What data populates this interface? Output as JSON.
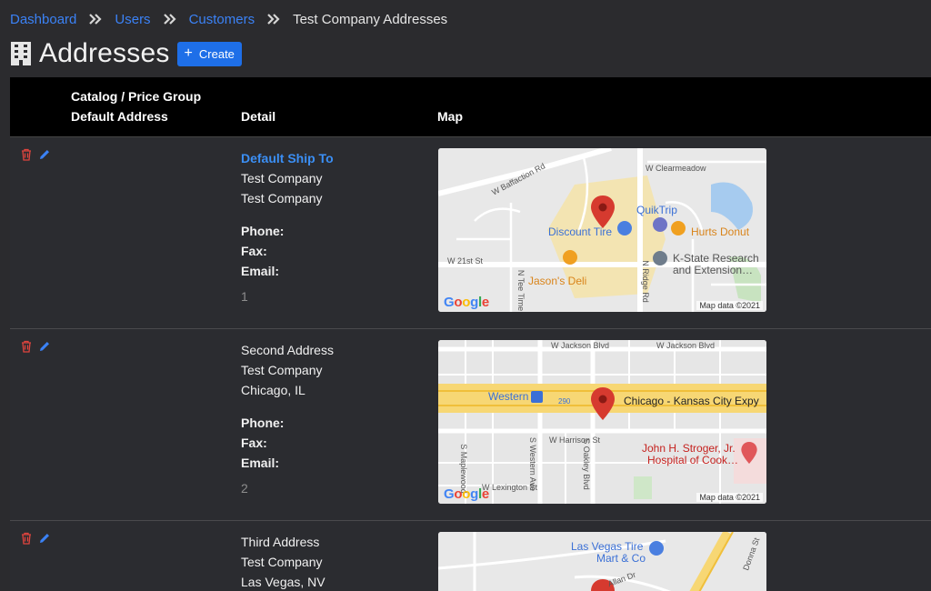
{
  "breadcrumb": {
    "items": [
      "Dashboard",
      "Users",
      "Customers"
    ],
    "current": "Test Company Addresses"
  },
  "page": {
    "title": "Addresses",
    "create_label": "Create"
  },
  "table": {
    "headers": {
      "catalog_line1": "Catalog / Price Group",
      "catalog_line2": "Default Address",
      "detail": "Detail",
      "map": "Map"
    },
    "labels": {
      "phone": "Phone:",
      "fax": "Fax:",
      "email": "Email:"
    },
    "rows": [
      {
        "name": "Default Ship To",
        "line2": "Test Company",
        "line3": "Test Company",
        "number": "1"
      },
      {
        "name": "Second Address",
        "line2": "Test Company",
        "line3": "Chicago, IL",
        "number": "2"
      },
      {
        "name": "Third Address",
        "line2": "Test Company",
        "line3": "Las Vegas, NV"
      }
    ]
  },
  "maps": {
    "credit": "Map data ©2021",
    "logo": [
      "G",
      "o",
      "o",
      "g",
      "l",
      "e"
    ],
    "map1": {
      "labels": [
        "W Baffaction Rd",
        "W Clearmeadow",
        "QuikTrip",
        "Discount Tire",
        "Hurts Donut",
        "W 21st St",
        "K-State Research",
        "and Extension…",
        "Jason's Deli",
        "N Tee Time",
        "N Ridge Rd"
      ]
    },
    "map2": {
      "labels": [
        "W Jackson Blvd",
        "W Jackson Blvd",
        "Western",
        "290",
        "Chicago - Kansas City Expy",
        "W Harrison St",
        "John H. Stroger, Jr.",
        "Hospital of Cook…",
        "S Western Ave",
        "S Oakley Blvd",
        "S Maplewood",
        "W Lexington St"
      ]
    },
    "map3": {
      "labels": [
        "Las Vegas Tire",
        "Mart & Co",
        "Donna St",
        "Allan Dr"
      ]
    }
  },
  "colors": {
    "background": "#2b2b2e",
    "header_bg": "#000000",
    "link": "#3b82f6",
    "button": "#1e6fe8",
    "delete_icon": "#e0443e",
    "edit_icon": "#3b82f6"
  }
}
